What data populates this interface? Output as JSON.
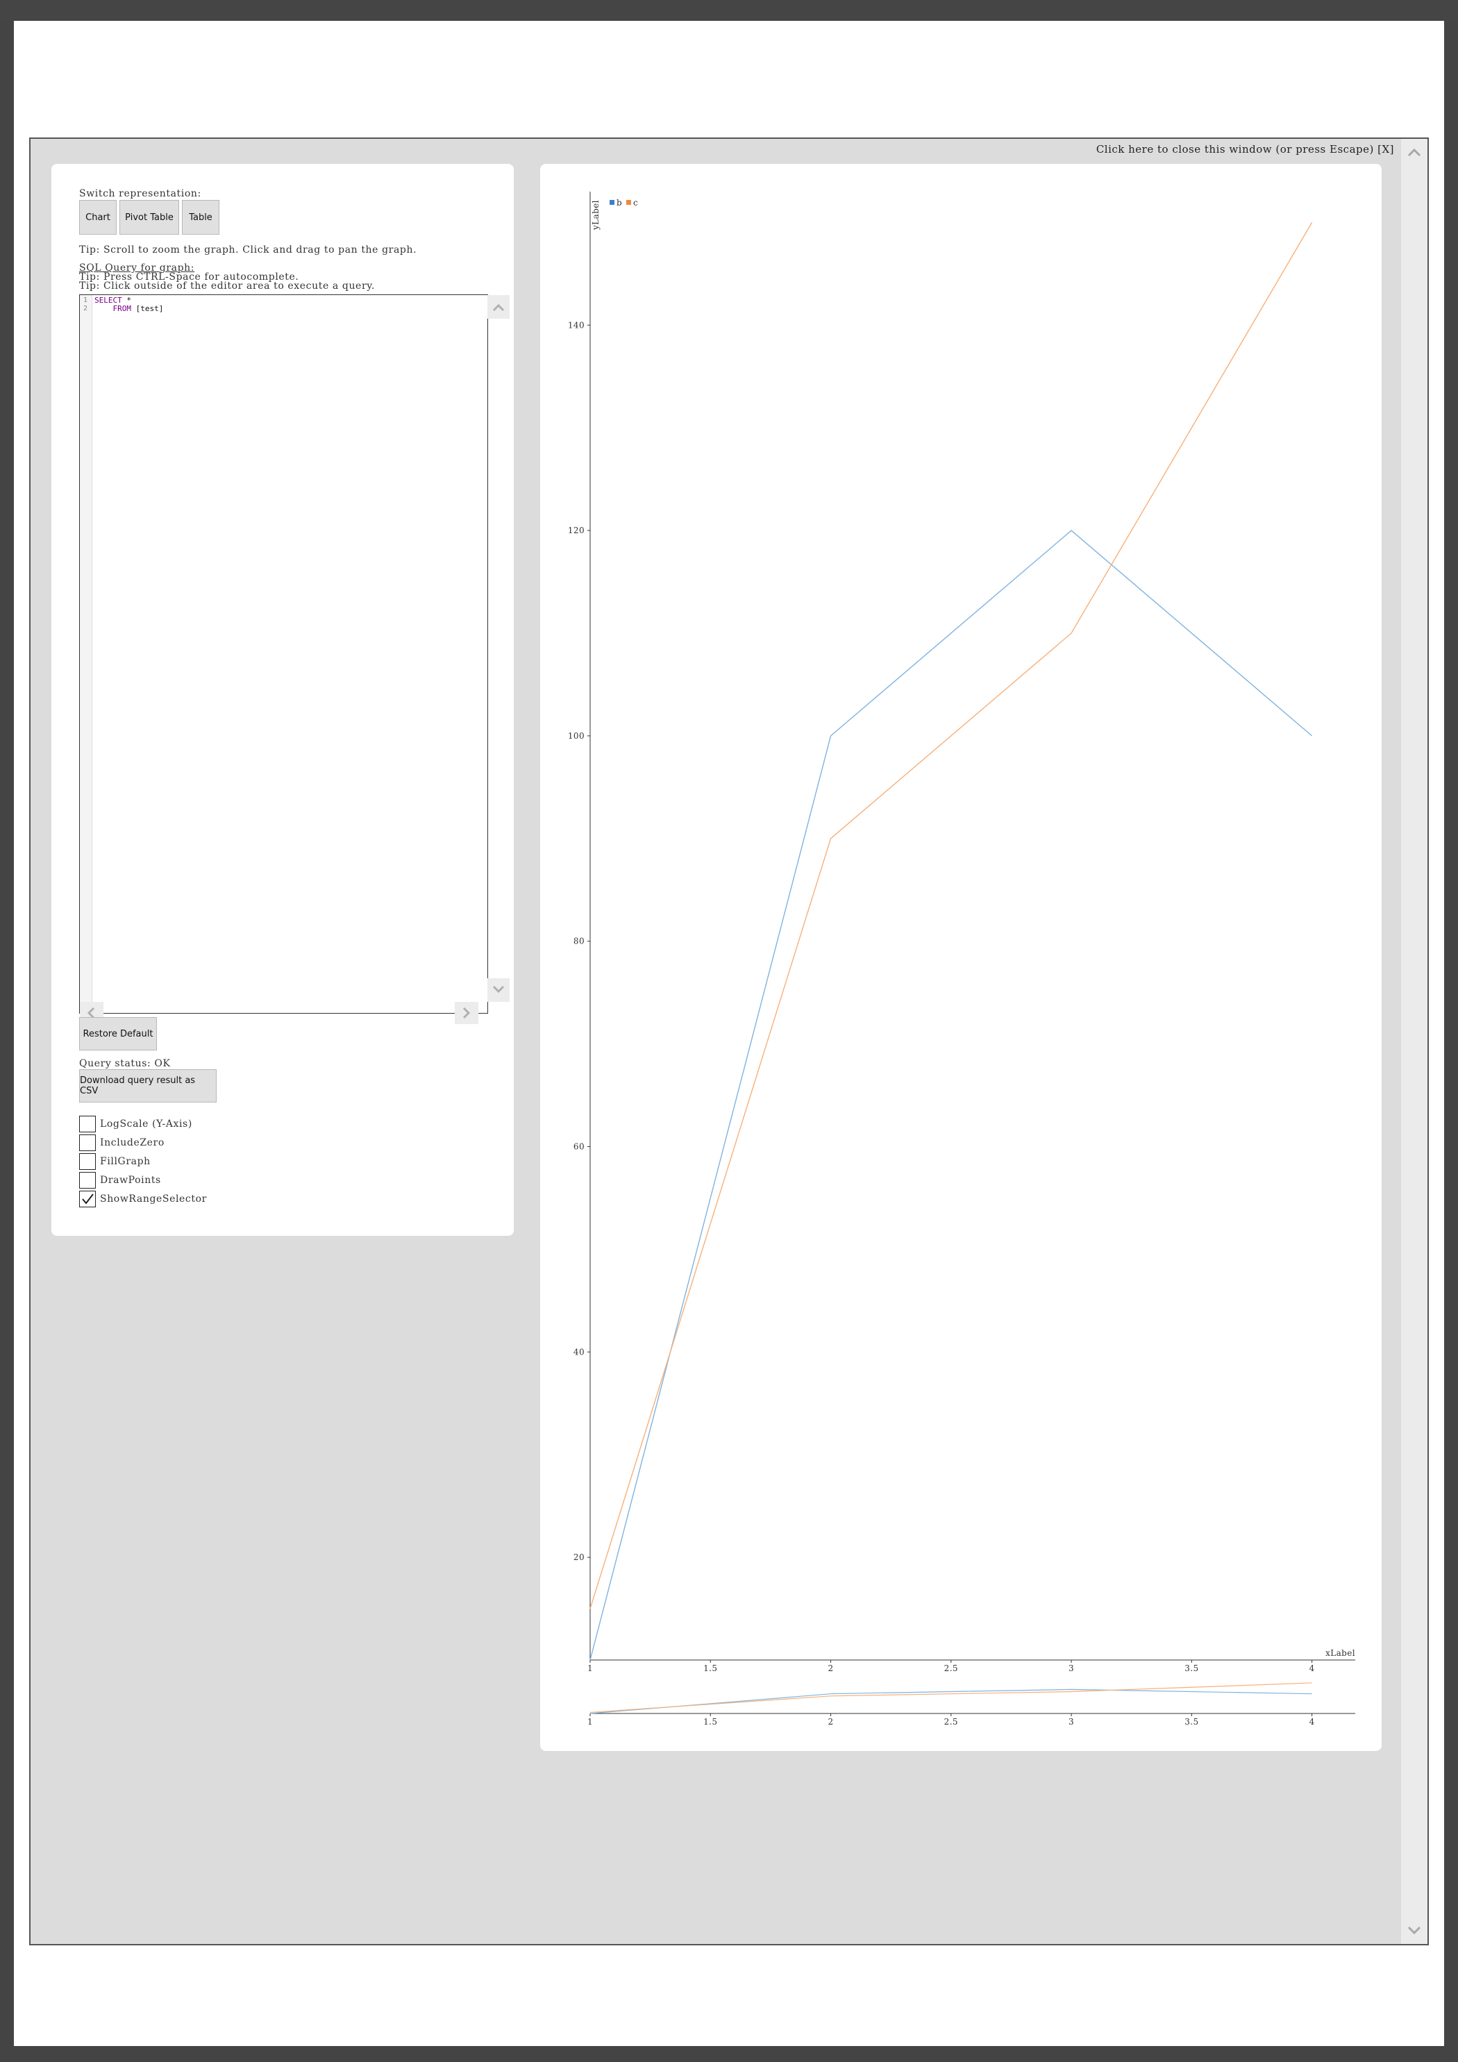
{
  "overlay": {
    "close_text": "Click here to close this window (or press Escape) [X]"
  },
  "left": {
    "switch_label": "Switch representation:",
    "buttons": {
      "chart": "Chart",
      "pivot": "Pivot Table",
      "table": "Table"
    },
    "tip_scroll": "Tip: Scroll to zoom the graph. Click and drag to pan the graph.",
    "sql_title": "SQL Query for graph:",
    "tip_ctrl": "Tip: Press CTRL-Space for autocomplete.",
    "tip_click": "Tip: Click outside of the editor area to execute a query.",
    "editor": {
      "lines": [
        {
          "num": "1",
          "keyword": "SELECT",
          "rest": " *"
        },
        {
          "num": "2",
          "keyword": "    FROM",
          "rest": " [test]"
        }
      ]
    },
    "restore_label": "Restore Default",
    "query_status": "Query status: OK",
    "csv_label": "Download query result as CSV",
    "options": [
      {
        "label": "LogScale (Y-Axis)",
        "checked": false
      },
      {
        "label": "IncludeZero",
        "checked": false
      },
      {
        "label": "FillGraph",
        "checked": false
      },
      {
        "label": "DrawPoints",
        "checked": false
      },
      {
        "label": "ShowRangeSelector",
        "checked": true
      }
    ]
  },
  "colors": {
    "series_b": "#7fb3e0",
    "series_c": "#f6b07a",
    "legend_b": "#3b7fcf",
    "legend_c": "#f08a3c"
  },
  "chart_data": {
    "type": "line",
    "xlabel": "xLabel",
    "ylabel": "yLabel",
    "x": [
      1,
      2,
      3,
      4
    ],
    "series": [
      {
        "name": "b",
        "values": [
          10,
          100,
          120,
          100
        ]
      },
      {
        "name": "c",
        "values": [
          15,
          90,
          110,
          150
        ]
      }
    ],
    "xlim": [
      1,
      4.18
    ],
    "ylim": [
      10,
      153
    ],
    "xticks": [
      "1",
      "1.5",
      "2",
      "2.5",
      "3",
      "3.5",
      "4"
    ],
    "yticks": [
      "20",
      "40",
      "60",
      "80",
      "100",
      "120",
      "140"
    ],
    "legend": "top-left",
    "grid": false,
    "range_selector": true
  }
}
